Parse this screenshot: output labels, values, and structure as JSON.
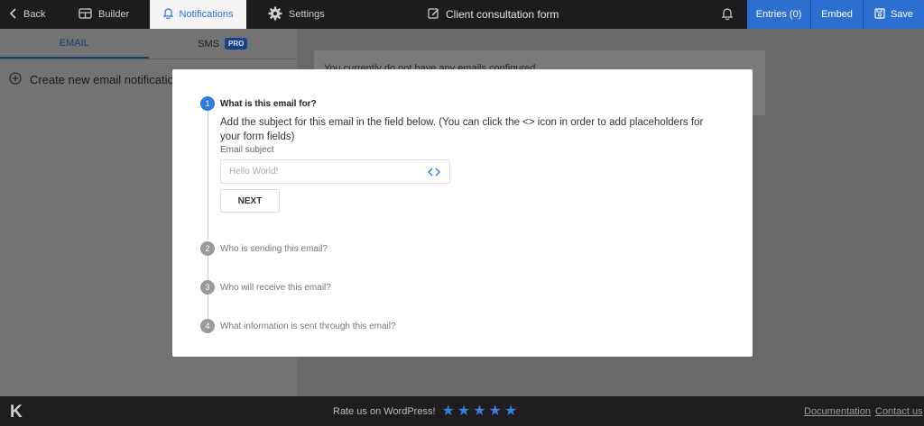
{
  "topbar": {
    "back_label": "Back",
    "builder_label": "Builder",
    "notifications_label": "Notifications",
    "settings_label": "Settings",
    "form_title": "Client consultation form",
    "entries_label": "Entries (0)",
    "embed_label": "Embed",
    "save_label": "Save"
  },
  "left_panel": {
    "tabs": [
      {
        "label": "EMAIL"
      },
      {
        "label": "SMS",
        "badge": "PRO"
      }
    ],
    "create_label": "Create new email notification"
  },
  "main": {
    "empty_message": "You currently do not have any emails configured"
  },
  "modal": {
    "steps": [
      {
        "number": "1",
        "title": "What is this email for?"
      },
      {
        "number": "2",
        "title": "Who is sending this email?"
      },
      {
        "number": "3",
        "title": "Who will receive this email?"
      },
      {
        "number": "4",
        "title": "What information is sent through this email?"
      }
    ],
    "instructions": "Add the subject for this email in the field below. (You can click the <> icon in order to add placeholders for your form fields)",
    "subject_label": "Email subject",
    "subject_placeholder": "Hello World!",
    "subject_value": "",
    "next_label": "NEXT"
  },
  "footer": {
    "rate_label": "Rate us on WordPress!",
    "star_count": 5,
    "documentation_label": "Documentation",
    "contact_label": "Contact us"
  },
  "colors": {
    "accent": "#2d6fd0",
    "topbar_bg": "#1c1c1c",
    "step_active": "#2f7be0",
    "star": "#3b7ddc"
  }
}
